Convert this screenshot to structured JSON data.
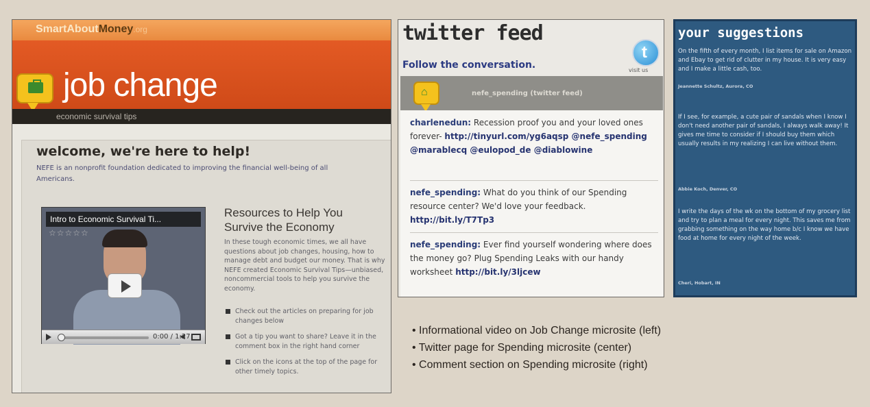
{
  "job_change": {
    "logo": {
      "part1": "Smart",
      "part2": "About",
      "part3": "Money",
      "part4": ".org"
    },
    "title": "job change",
    "subtitle": "economic survival tips",
    "welcome": "welcome, we're here to help!",
    "intro": "NEFE is an nonprofit foundation dedicated to improving the financial well-being of all Americans.",
    "video": {
      "title": "Intro to Economic Survival Ti...",
      "rating": "☆☆☆☆☆",
      "time": "0:00 / 1:27"
    },
    "resources_title": "Resources to Help You Survive the Economy",
    "resources_text": "In these tough economic times, we all have questions about job changes, housing, how to manage debt and budget our money. That is why NEFE created Economic Survival Tips—unbiased, noncommercial tools to help you survive the economy.",
    "resources_list": [
      "Check out the articles on preparing for job changes below",
      "Got a tip you want to share? Leave it in the comment box in the right hand corner",
      "Click on the icons at the top of the page for other timely topics."
    ]
  },
  "twitter": {
    "title": "twitter feed",
    "subtitle": "Follow the conversation.",
    "visit": "visit us",
    "handle": "nefe_spending (twitter feed)",
    "tweets": [
      {
        "user": "charlenedun:",
        "text": " Recession proof you and your loved ones forever- ",
        "link": "http://tinyurl.com/yg6aqsp @nefe_spending @marablecq @eulopod_de @diablowine"
      },
      {
        "user": "nefe_spending:",
        "text": " What do you think of our Spending resource center? We'd love your feedback. ",
        "link": "http://bit.ly/T7Tp3"
      },
      {
        "user": "nefe_spending:",
        "text": " Ever find yourself wondering where does the money go? Plug Spending Leaks with our handy worksheet ",
        "link": "http://bit.ly/3ljcew"
      }
    ]
  },
  "suggestions": {
    "title": "your suggestions",
    "items": [
      {
        "text": "On the fifth of every month, I list items for sale on Amazon and Ebay to get rid of clutter in my house. It is very easy and I make a little cash, too.",
        "name": "Jeannette Schultz, Aurora, CO"
      },
      {
        "text": "If I see, for example, a cute pair of sandals when I know I don't need another pair of sandals, I always walk away! It gives me time to consider if I should buy them which usually results in my realizing I can live without them.",
        "name": "Abbie Koch, Denver, CO"
      },
      {
        "text": "I write the days of the wk on the bottom of my grocery list and try to plan a meal for every night. This saves me from grabbing something on the way home b/c I know we have food at home for every night of the week.",
        "name": "Cheri, Hobart, IN"
      }
    ]
  },
  "captions": [
    "• Informational video on Job Change microsite (left)",
    "• Twitter page for Spending microsite (center)",
    "• Comment section on Spending microsite (right)"
  ]
}
